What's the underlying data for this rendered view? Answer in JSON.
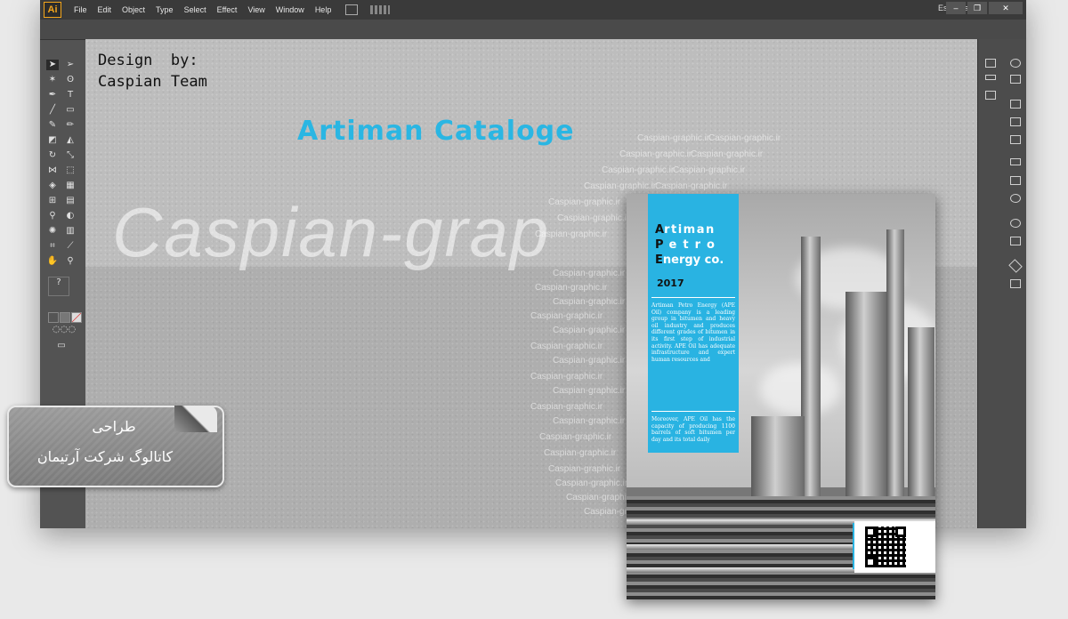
{
  "app": {
    "logo": "Ai",
    "menu": [
      "File",
      "Edit",
      "Object",
      "Type",
      "Select",
      "Effect",
      "View",
      "Window",
      "Help"
    ],
    "workspace": "Essentials",
    "window_controls": {
      "minimize": "–",
      "restore": "❐",
      "close": "✕"
    }
  },
  "artboard": {
    "design_by": "Design  by:\nCaspian Team",
    "title": "Artiman Cataloge",
    "watermark": "Caspian-grap",
    "wm_small": "Caspian-graphic.ir"
  },
  "catalog": {
    "heading_line1": "rtiman",
    "heading_line2": "etro",
    "heading_line3": "nergy co.",
    "heading_k1": "A",
    "heading_k2": "P",
    "heading_k3": "E",
    "year": "2017",
    "para1": "Artiman Petro Energy (APE Oil) company is a leading group in bitumen and heavy oil industry and produces different grades of bitumen in its first step of industrial activity. APE Oil has adequate infrastructure and expert human resources and",
    "para2": "Moreover, APE Oil has the capacity of producing 1100 barrels of soft bitumen per day and its total daily"
  },
  "badge": {
    "line1": "طراحی",
    "line2": "کاتالوگ شرکت آرتیمان"
  },
  "colors": {
    "accent": "#29b3e2",
    "ai_orange": "#f3a51c"
  }
}
